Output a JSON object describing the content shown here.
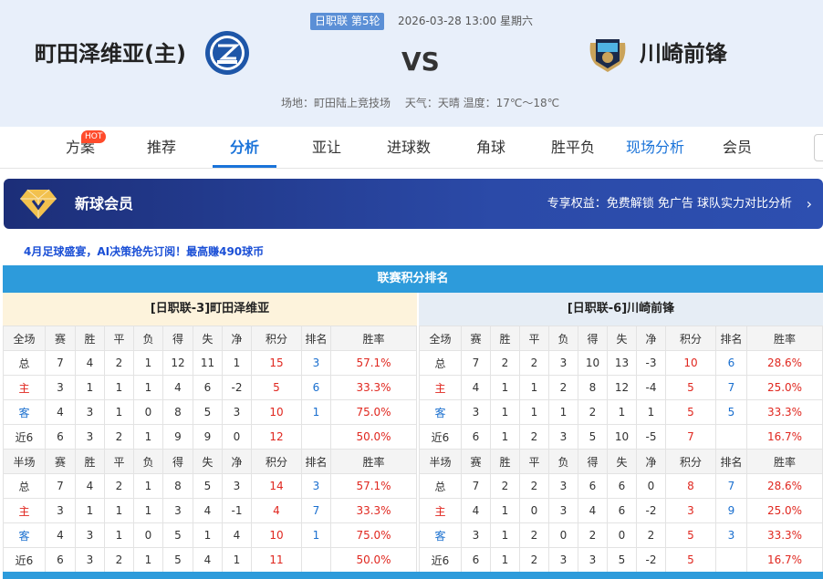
{
  "match": {
    "league_round": "日职联 第5轮",
    "datetime": "2026-03-28 13:00 星期六",
    "home_team": "町田泽维亚(主)",
    "away_team": "川崎前锋",
    "vs": "VS",
    "venue": "场地：町田陆上竞技场",
    "weather": "天气：天晴 温度：17℃～18℃"
  },
  "nav": {
    "items": [
      "方案",
      "推荐",
      "分析",
      "亚让",
      "进球数",
      "角球",
      "胜平负",
      "现场分析",
      "会员"
    ],
    "hot": "HOT",
    "active": "分析"
  },
  "vip": {
    "title": "新球会员",
    "benefit": "专享权益：免费解锁 免广告 球队实力对比分析"
  },
  "promo": "4月足球盛宴，AI决策抢先订阅！最高赚490球币",
  "ranking": {
    "title": "联赛积分排名",
    "home_label": "[日职联-3]町田泽维亚",
    "away_label": "[日职联-6]川崎前锋",
    "full_header": [
      "全场",
      "赛",
      "胜",
      "平",
      "负",
      "得",
      "失",
      "净",
      "积分",
      "排名",
      "胜率"
    ],
    "half_header": [
      "半场",
      "赛",
      "胜",
      "平",
      "负",
      "得",
      "失",
      "净",
      "积分",
      "排名",
      "胜率"
    ],
    "home_full": [
      [
        "总",
        "7",
        "4",
        "2",
        "1",
        "12",
        "11",
        "1",
        "15",
        "3",
        "57.1%"
      ],
      [
        "主",
        "3",
        "1",
        "1",
        "1",
        "4",
        "6",
        "-2",
        "5",
        "6",
        "33.3%"
      ],
      [
        "客",
        "4",
        "3",
        "1",
        "0",
        "8",
        "5",
        "3",
        "10",
        "1",
        "75.0%"
      ],
      [
        "近6",
        "6",
        "3",
        "2",
        "1",
        "9",
        "9",
        "0",
        "12",
        "",
        "50.0%"
      ]
    ],
    "home_half": [
      [
        "总",
        "7",
        "4",
        "2",
        "1",
        "8",
        "5",
        "3",
        "14",
        "3",
        "57.1%"
      ],
      [
        "主",
        "3",
        "1",
        "1",
        "1",
        "3",
        "4",
        "-1",
        "4",
        "7",
        "33.3%"
      ],
      [
        "客",
        "4",
        "3",
        "1",
        "0",
        "5",
        "1",
        "4",
        "10",
        "1",
        "75.0%"
      ],
      [
        "近6",
        "6",
        "3",
        "2",
        "1",
        "5",
        "4",
        "1",
        "11",
        "",
        "50.0%"
      ]
    ],
    "away_full": [
      [
        "总",
        "7",
        "2",
        "2",
        "3",
        "10",
        "13",
        "-3",
        "10",
        "6",
        "28.6%"
      ],
      [
        "主",
        "4",
        "1",
        "1",
        "2",
        "8",
        "12",
        "-4",
        "5",
        "7",
        "25.0%"
      ],
      [
        "客",
        "3",
        "1",
        "1",
        "1",
        "2",
        "1",
        "1",
        "5",
        "5",
        "33.3%"
      ],
      [
        "近6",
        "6",
        "1",
        "2",
        "3",
        "5",
        "10",
        "-5",
        "7",
        "",
        "16.7%"
      ]
    ],
    "away_half": [
      [
        "总",
        "7",
        "2",
        "2",
        "3",
        "6",
        "6",
        "0",
        "8",
        "7",
        "28.6%"
      ],
      [
        "主",
        "4",
        "1",
        "0",
        "3",
        "4",
        "6",
        "-2",
        "3",
        "9",
        "25.0%"
      ],
      [
        "客",
        "3",
        "1",
        "2",
        "0",
        "2",
        "0",
        "2",
        "5",
        "3",
        "33.3%"
      ],
      [
        "近6",
        "6",
        "1",
        "2",
        "3",
        "3",
        "5",
        "-2",
        "5",
        "",
        "16.7%"
      ]
    ]
  },
  "colors": {
    "accent": "#1a73d9",
    "header_bar": "#2d9bdb",
    "red": "#e0271f",
    "home_bg": "#fdf3dc",
    "away_bg": "#e6edf5"
  }
}
